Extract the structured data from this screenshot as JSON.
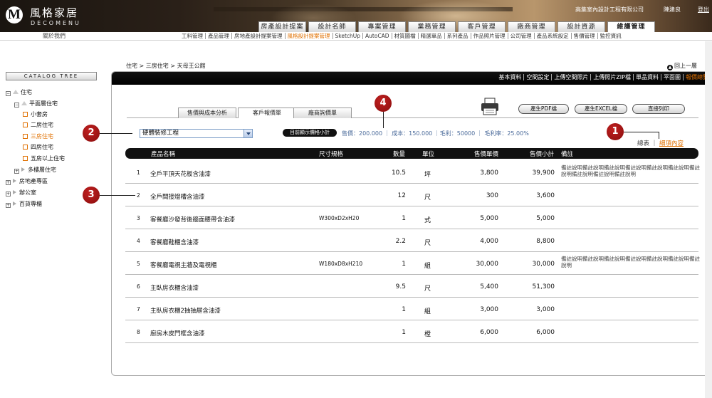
{
  "header": {
    "logo_mark": "M",
    "logo_title": "風格家居",
    "logo_sub": "DECOMENU",
    "company": "高集室內設計工程有限公司",
    "user": "陳建良",
    "logout": "登出"
  },
  "main_nav": [
    "房產設計提案",
    "設計名師",
    "專案管理",
    "業務管理",
    "客戶管理",
    "廠商管理",
    "設計資源",
    "維護管理"
  ],
  "sub_nav": [
    "工料管理",
    "產品管理",
    "房地產設計提案管理",
    "風格設計提案管理",
    "SketchUp",
    "AutoCAD",
    "材質圖檔",
    "精選單品",
    "系列產品",
    "作品照片管理",
    "公司管理",
    "產品系統設定",
    "售價管理",
    "監控資訊"
  ],
  "about": "關於我們",
  "sidebar": {
    "catalog": "CATALOG TREE",
    "items": [
      {
        "label": "住宅"
      },
      {
        "label": "平面層住宅"
      },
      {
        "label": "小套房"
      },
      {
        "label": "二房住宅"
      },
      {
        "label": "三房住宅"
      },
      {
        "label": "四房住宅"
      },
      {
        "label": "五房以上住宅"
      },
      {
        "label": "多樓層住宅"
      },
      {
        "label": "房地產專區"
      },
      {
        "label": "辦公室"
      },
      {
        "label": "百貨專櫃"
      }
    ]
  },
  "breadcrumb": "住宅 > 三房住宅 > 天母王公館",
  "back": "回上一層",
  "panel_nav": [
    "基本資料",
    "空間設定",
    "上傳空間照片",
    "上傳照片ZIP檔",
    "單品資料",
    "平面圖",
    "報價總覽"
  ],
  "tabs": [
    "售價與成本分析",
    "客戶報價單",
    "廠商詢價單"
  ],
  "buttons": {
    "pdf": "產生PDF檔",
    "excel": "產生EXCEL檔",
    "print": "直接列印"
  },
  "filter": {
    "selected": "硬體裝修工程",
    "subtotal_btn": "目前顯示價格小計",
    "summary": "售價：200.000 ｜ 成本：150.000 ｜毛利：50000 ｜ 毛利率：25.00%"
  },
  "view": {
    "summary": "總表",
    "detail": "細項內容",
    "sep": "｜"
  },
  "table": {
    "headers": [
      "產品名稱",
      "尺寸規格",
      "數量",
      "單位",
      "售價單價",
      "售價小計",
      "備註"
    ],
    "rows": [
      {
        "no": "1",
        "name": "全戶平頂天花板含油漆",
        "size": "",
        "qty": "10.5",
        "unit": "坪",
        "price": "3,800",
        "subtotal": "39,900",
        "note": "備註說明備註說明備註說明備註說明備註說明備註說明備註說明備註說明備註說明備註說明"
      },
      {
        "no": "2",
        "name": "全戶間接燈槽含油漆",
        "size": "",
        "qty": "12",
        "unit": "尺",
        "price": "300",
        "subtotal": "3,600",
        "note": ""
      },
      {
        "no": "3",
        "name": "客餐廳沙發背後牆面腰帶含油漆",
        "size": "W300xD2xH20",
        "qty": "1",
        "unit": "式",
        "price": "5,000",
        "subtotal": "5,000",
        "note": ""
      },
      {
        "no": "4",
        "name": "客餐廳鞋櫃含油漆",
        "size": "",
        "qty": "2.2",
        "unit": "尺",
        "price": "4,000",
        "subtotal": "8,800",
        "note": ""
      },
      {
        "no": "5",
        "name": "客餐廳電視主牆及電視櫃",
        "size": "W180xD8xH210",
        "qty": "1",
        "unit": "組",
        "price": "30,000",
        "subtotal": "30,000",
        "note": "備註說明備註說明備註說明備註說明備註說明備註說明備註說明"
      },
      {
        "no": "6",
        "name": "主臥房衣櫃含油漆",
        "size": "",
        "qty": "9.5",
        "unit": "尺",
        "price": "5,400",
        "subtotal": "51,300",
        "note": ""
      },
      {
        "no": "7",
        "name": "主臥房衣櫃2抽抽屜含油漆",
        "size": "",
        "qty": "1",
        "unit": "組",
        "price": "3,000",
        "subtotal": "3,000",
        "note": ""
      },
      {
        "no": "8",
        "name": "廚房木皮門框含油漆",
        "size": "",
        "qty": "1",
        "unit": "樘",
        "price": "6,000",
        "subtotal": "6,000",
        "note": ""
      }
    ]
  },
  "markers": [
    "1",
    "2",
    "3",
    "4"
  ]
}
